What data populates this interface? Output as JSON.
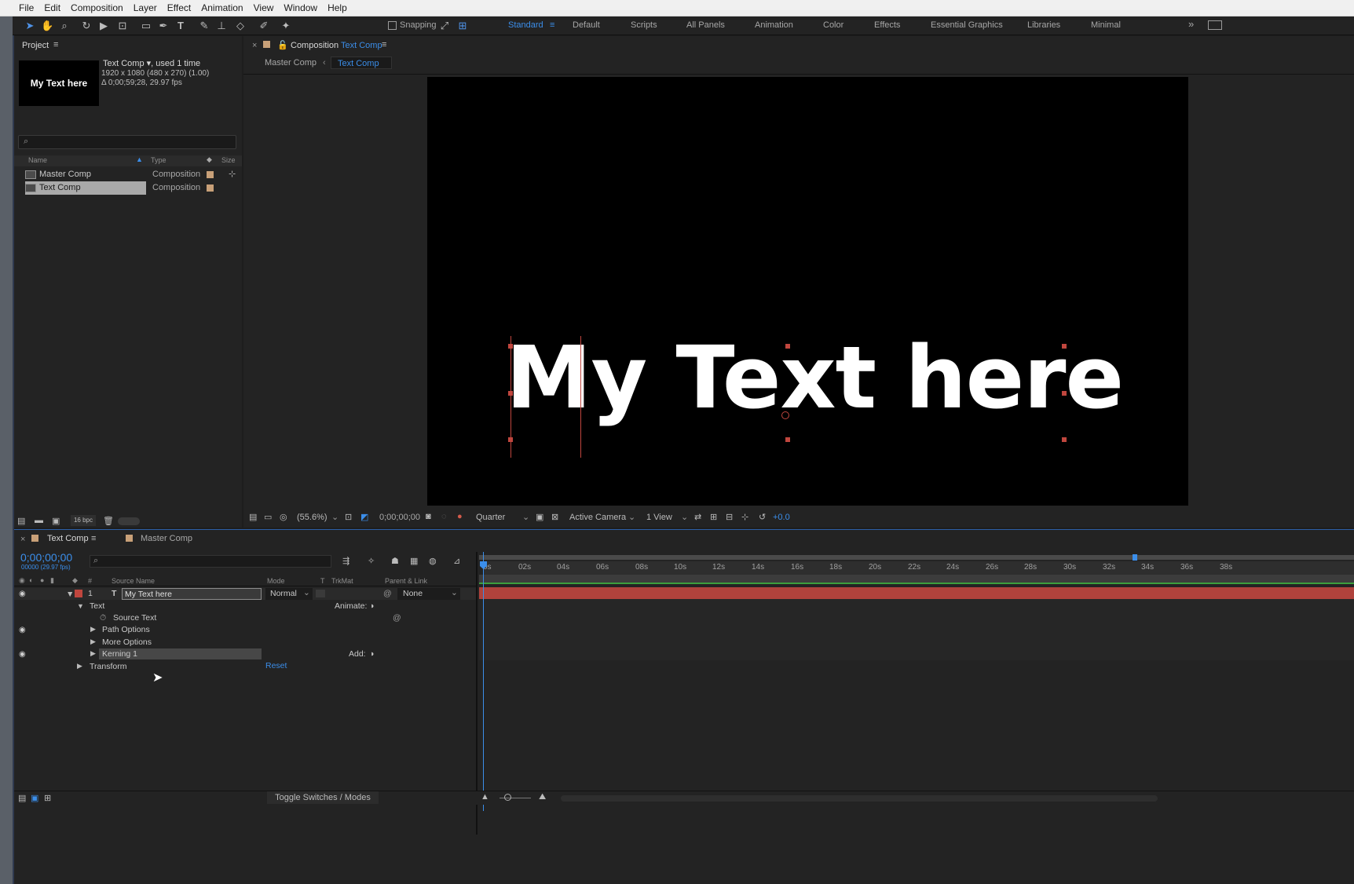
{
  "menu": [
    "File",
    "Edit",
    "Composition",
    "Layer",
    "Effect",
    "Animation",
    "View",
    "Window",
    "Help"
  ],
  "toolbar": {
    "snapping_label": "Snapping",
    "workspaces": [
      "Standard",
      "Default",
      "Scripts",
      "All Panels",
      "Animation",
      "Color",
      "Effects",
      "Essential Graphics",
      "Libraries",
      "Minimal"
    ],
    "active_workspace": "Standard",
    "overflow": "»"
  },
  "project": {
    "tab": "Project",
    "comp_name": "Text Comp",
    "used": ", used 1 time",
    "dims": "1920 x 1080  (480 x 270) (1.00)",
    "duration": "Δ 0;00;59;28, 29.97 fps",
    "thumb_text": "My Text here",
    "columns": {
      "name": "Name",
      "type": "Type",
      "size": "Size"
    },
    "items": [
      {
        "name": "Master Comp",
        "type": "Composition"
      },
      {
        "name": "Text Comp",
        "type": "Composition"
      }
    ],
    "bpc": "16 bpc"
  },
  "viewer": {
    "tab_prefix": "Composition",
    "tab_comp": "Text Comp",
    "breadcrumb": [
      "Master Comp",
      "Text Comp"
    ],
    "canvas_text": "My Text here",
    "zoom": "(55.6%)",
    "timecode": "0;00;00;00",
    "resolution": "Quarter",
    "camera": "Active Camera",
    "views": "1 View",
    "exposure": "+0.0"
  },
  "timeline": {
    "tabs": [
      "Text Comp",
      "Master Comp"
    ],
    "timecode": "0;00;00;00",
    "frame_info": "00000 (29.97 fps)",
    "columns": {
      "num": "#",
      "source": "Source Name",
      "mode": "Mode",
      "t": "T",
      "trkmat": "TrkMat",
      "parent": "Parent & Link"
    },
    "layer": {
      "index": "1",
      "type": "T",
      "name": "My Text here",
      "mode": "Normal",
      "parent": "None"
    },
    "props": {
      "text": "Text",
      "animate": "Animate:",
      "source_text": "Source Text",
      "path_options": "Path Options",
      "more_options": "More Options",
      "kerning": "Kerning 1",
      "add": "Add:",
      "transform": "Transform",
      "reset": "Reset"
    },
    "ticks": [
      "0s",
      "02s",
      "04s",
      "06s",
      "08s",
      "10s",
      "12s",
      "14s",
      "16s",
      "18s",
      "20s",
      "22s",
      "24s",
      "26s",
      "28s",
      "30s",
      "32s",
      "34s",
      "36s",
      "38s"
    ],
    "toggle_label": "Toggle Switches / Modes"
  },
  "colors": {
    "accent": "#3b8eea",
    "layer_bar": "#b0423c",
    "label_red": "#c0463e",
    "swatch": "#c8a078"
  }
}
